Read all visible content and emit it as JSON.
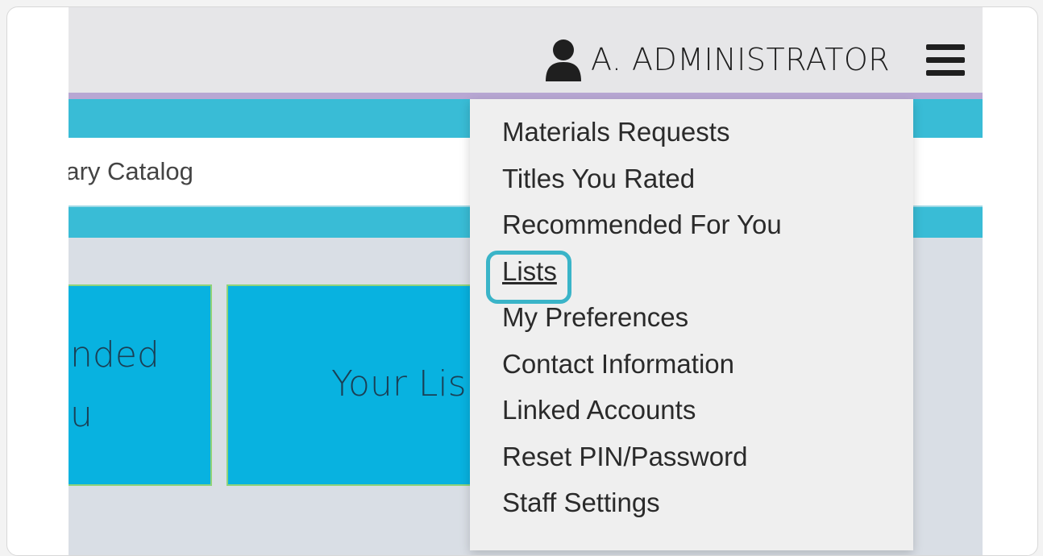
{
  "header": {
    "user_name": "A. ADMINISTRATOR"
  },
  "search": {
    "partial_text": "rary Catalog"
  },
  "tiles": [
    {
      "line1": "nded",
      "line2": "u"
    },
    {
      "line1": "Your Lis"
    }
  ],
  "menu": {
    "items": [
      {
        "label": "Materials Requests"
      },
      {
        "label": "Titles You Rated"
      },
      {
        "label": "Recommended For You"
      },
      {
        "label": "Lists",
        "active": true
      },
      {
        "label": "My Preferences"
      },
      {
        "label": "Contact Information"
      },
      {
        "label": "Linked Accounts"
      },
      {
        "label": "Reset PIN/Password"
      },
      {
        "label": "Staff Settings"
      }
    ]
  },
  "colors": {
    "header_bg": "#e6e6e8",
    "accent_band": "#39bcd6",
    "tile_bg": "#08b2e0",
    "focus_ring": "#3ab4c8",
    "dropdown_bg": "#efefef"
  },
  "icons": {
    "user": "user-icon",
    "menu": "hamburger-menu-icon"
  }
}
